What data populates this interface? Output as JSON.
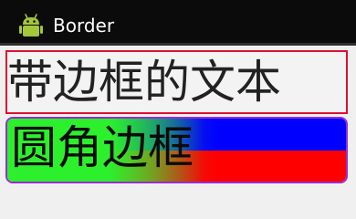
{
  "action_bar": {
    "title": "Border",
    "icon": "android-robot-icon",
    "background": "#0b0b0b",
    "icon_color": "#a4c639"
  },
  "content": {
    "bordered_text": "带边框的文本",
    "rounded_text": "圆角边框",
    "border_color": "#e01030",
    "rounded_border_color": "#9a2bd8",
    "gradient_colors": [
      "#2cf02c",
      "#0000ff",
      "#ff0000"
    ]
  }
}
